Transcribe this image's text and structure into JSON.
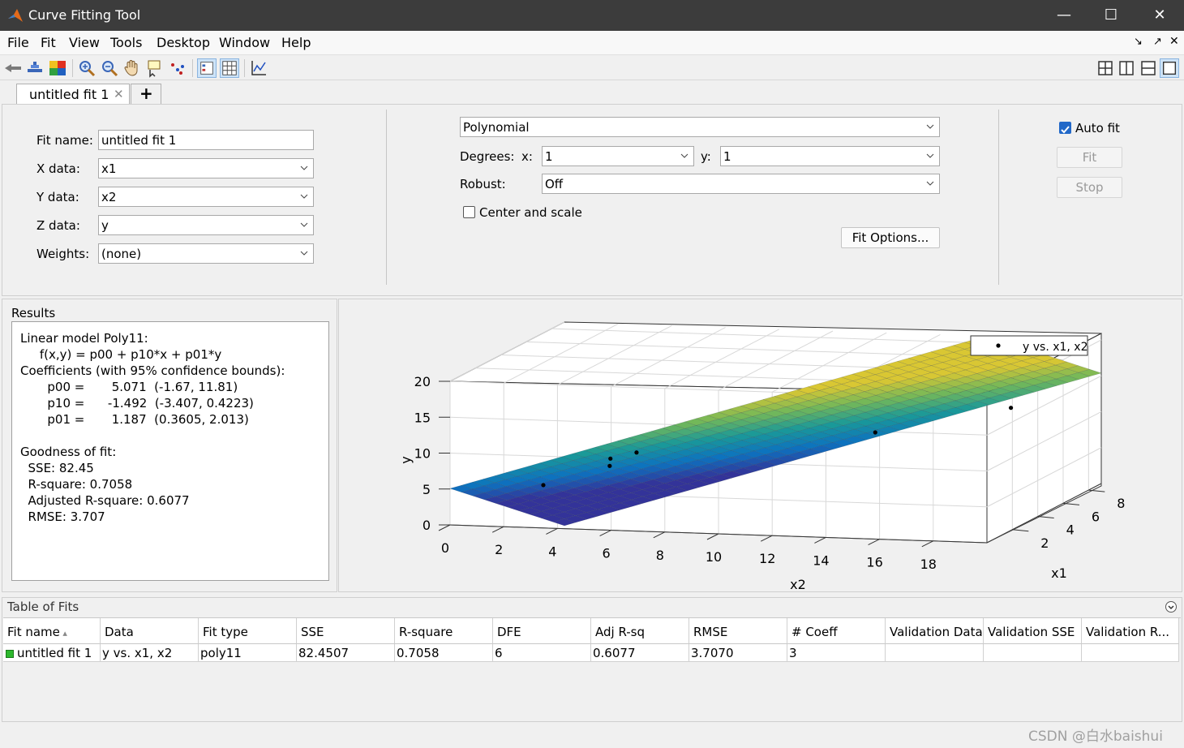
{
  "window": {
    "title": "Curve Fitting Tool"
  },
  "menu": [
    "File",
    "Fit",
    "View",
    "Tools",
    "Desktop",
    "Window",
    "Help"
  ],
  "tab": {
    "label": "untitled fit 1",
    "add": "+"
  },
  "fit": {
    "name_label": "Fit name:",
    "name_value": "untitled fit 1",
    "x_label": "X data:",
    "x_value": "x1",
    "y_label": "Y data:",
    "y_value": "x2",
    "z_label": "Z data:",
    "z_value": "y",
    "w_label": "Weights:",
    "w_value": "(none)"
  },
  "model": {
    "type": "Polynomial",
    "degrees_label": "Degrees:",
    "deg_x_label": "x:",
    "deg_x": "1",
    "deg_y_label": "y:",
    "deg_y": "1",
    "robust_label": "Robust:",
    "robust": "Off",
    "center_scale": "Center and scale",
    "fit_options": "Fit Options..."
  },
  "controls": {
    "auto_fit": "Auto fit",
    "fit": "Fit",
    "stop": "Stop"
  },
  "results": {
    "title": "Results",
    "lines": [
      "Linear model Poly11:",
      "     f(x,y) = p00 + p10*x + p01*y",
      "Coefficients (with 95% confidence bounds):",
      "       p00 =       5.071  (-1.67, 11.81)",
      "       p10 =      -1.492  (-3.407, 0.4223)",
      "       p01 =       1.187  (0.3605, 2.013)",
      "",
      "Goodness of fit:",
      "  SSE: 82.45",
      "  R-square: 0.7058",
      "  Adjusted R-square: 0.6077",
      "  RMSE: 3.707"
    ]
  },
  "chart_data": {
    "type": "scatter",
    "legend": "y vs. x1, x2",
    "legend_position": "top-right",
    "xlabel": "x2",
    "ylabel": "y",
    "zlabel": "x1",
    "x2_ticks": [
      "0",
      "2",
      "4",
      "6",
      "8",
      "10",
      "12",
      "14",
      "16",
      "18"
    ],
    "y_ticks": [
      "0",
      "5",
      "10",
      "15",
      "20"
    ],
    "x1_ticks": [
      "2",
      "4",
      "6",
      "8"
    ],
    "x2_range": [
      0,
      20
    ],
    "y_range": [
      0,
      20
    ],
    "x1_range": [
      0,
      9
    ],
    "grid": true,
    "surface": {
      "model": "y = 5.071 - 1.492*x1 + 1.187*x2",
      "colormap": "parula"
    },
    "points": [
      {
        "x2": 3,
        "x1": 1,
        "y": 5
      },
      {
        "x2": 5,
        "x1": 2,
        "y": 7
      },
      {
        "x2": 5.5,
        "x1": 1,
        "y": 9
      },
      {
        "x2": 6,
        "x1": 2,
        "y": 9
      },
      {
        "x2": 13,
        "x1": 6,
        "y": 9
      },
      {
        "x2": 19,
        "x1": 4,
        "y": 15
      }
    ]
  },
  "table": {
    "title": "Table of Fits",
    "columns": [
      "Fit name",
      "Data",
      "Fit type",
      "SSE",
      "R-square",
      "DFE",
      "Adj R-sq",
      "RMSE",
      "# Coeff",
      "Validation Data",
      "Validation SSE",
      "Validation R..."
    ],
    "rows": [
      [
        "untitled fit 1",
        "y vs. x1, x2",
        "poly11",
        "82.4507",
        "0.7058",
        "6",
        "0.6077",
        "3.7070",
        "3",
        "",
        "",
        ""
      ]
    ]
  },
  "watermark": "CSDN @白水baishui"
}
